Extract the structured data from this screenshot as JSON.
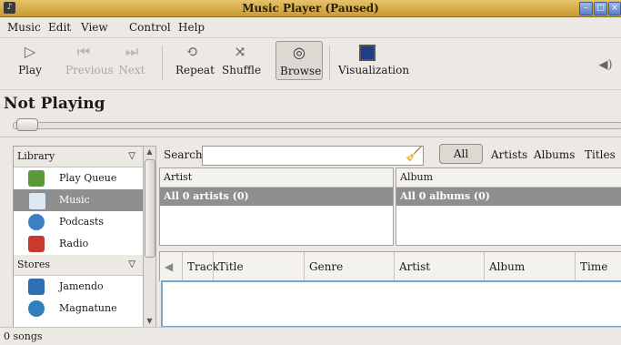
{
  "window": {
    "title": "Music Player (Paused)"
  },
  "menu": [
    "Music",
    "Edit",
    "View",
    "Control",
    "Help"
  ],
  "toolbar": {
    "play": "Play",
    "previous": "Previous",
    "next": "Next",
    "repeat": "Repeat",
    "shuffle": "Shuffle",
    "browse": "Browse",
    "visualization": "Visualization"
  },
  "now_playing": "Not Playing",
  "sidebar": {
    "library_header": "Library",
    "library_items": [
      "Play Queue",
      "Music",
      "Podcasts",
      "Radio"
    ],
    "selected": "Music",
    "stores_header": "Stores",
    "store_items": [
      "Jamendo",
      "Magnatune"
    ]
  },
  "search": {
    "label": "Search:",
    "value": "",
    "filters": [
      "All",
      "Artists",
      "Albums",
      "Titles"
    ],
    "selected_filter": "All"
  },
  "browser": {
    "artist_header": "Artist",
    "artist_row": "All 0 artists (0)",
    "album_header": "Album",
    "album_row": "All 0 albums (0)"
  },
  "tracks": {
    "columns": [
      "Track",
      "Title",
      "Genre",
      "Artist",
      "Album",
      "Time"
    ]
  },
  "status": "0 songs",
  "colors": {
    "titlebar": "#d4a744",
    "selection": "#8f8f8f",
    "focus": "#7aa5c7"
  }
}
